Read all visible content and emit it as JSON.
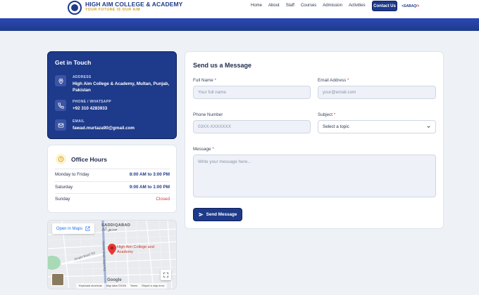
{
  "header": {
    "brand_name": "HIGH AIM COLLEGE & ACADEMY",
    "brand_tagline": "YOUR FUTURE IS OUR AIM",
    "nav": [
      "Home",
      "About",
      "Staff",
      "Courses",
      "Admission",
      "Activities"
    ],
    "cta_label": "Contact Us",
    "sabaq_prefix": "<SABAQ",
    "sabaq_suffix": "/>"
  },
  "contact": {
    "title": "Get in Touch",
    "items": [
      {
        "label": "ADDRESS",
        "value": "High Aim College & Academy, Multan, Punjab, Pakistan",
        "icon": "map-pin-icon"
      },
      {
        "label": "PHONE / WHATSAPP",
        "value": "+92 310 4283933",
        "icon": "phone-icon"
      },
      {
        "label": "EMAIL",
        "value": "fawad.murtaza90@gmail.com",
        "icon": "mail-icon"
      }
    ]
  },
  "hours": {
    "title": "Office Hours",
    "rows": [
      {
        "day": "Monday to Friday",
        "time": "8:00 AM to 3:00 PM"
      },
      {
        "day": "Saturday",
        "time": "9:00 AM to 1:00 PM"
      },
      {
        "day": "Sunday",
        "time": "Closed"
      }
    ]
  },
  "map": {
    "open_label": "Open in Maps",
    "area_label": "SADDIQABAD",
    "area_label_urdu": "صدیق آباد",
    "marker_label": "High Aim College and Academy",
    "street_1": "Jangla Basti Rd",
    "street_2": "Hazrat Shah Alam Rd",
    "google": "Google",
    "footer": [
      "Keyboard shortcuts",
      "Map data ©2026",
      "Terms",
      "Report a map error"
    ]
  },
  "form": {
    "title": "Send us a Message",
    "full_name": {
      "label": "Full Name",
      "placeholder": "Your full name"
    },
    "email": {
      "label": "Email Address",
      "placeholder": "your@email.com"
    },
    "phone": {
      "label": "Phone Number",
      "placeholder": "03XX-XXXXXXX"
    },
    "subject": {
      "label": "Subject",
      "value": "Select a topic"
    },
    "message": {
      "label": "Message",
      "placeholder": "Write your message here..."
    },
    "required_mark": "*",
    "send_label": "Send Message"
  },
  "colors": {
    "primary": "#1e3a8a",
    "accent": "#d4a017",
    "danger": "#d33b3b"
  }
}
